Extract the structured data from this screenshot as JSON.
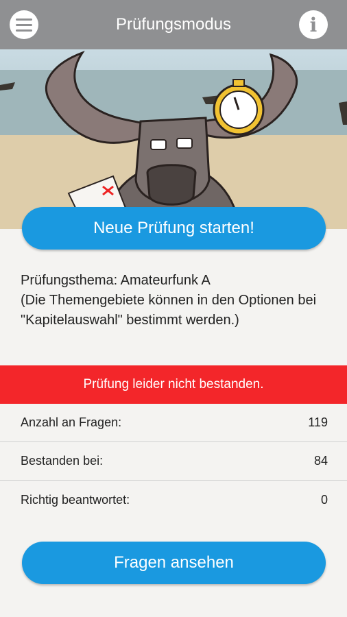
{
  "header": {
    "title": "Prüfungsmodus",
    "menu_icon": "hamburger-menu-icon",
    "info_icon": "info-icon"
  },
  "actions": {
    "start_label": "Neue Prüfung starten!",
    "review_label": "Fragen ansehen"
  },
  "topic": {
    "line": "Prüfungsthema: Amateurfunk A",
    "hint": "(Die Themengebiete können in den Optionen bei \"Kapitelauswahl\" bestimmt werden.)"
  },
  "result": {
    "banner": "Prüfung leider nicht bestanden."
  },
  "stats": [
    {
      "label": "Anzahl an Fragen:",
      "value": "119"
    },
    {
      "label": "Bestanden bei:",
      "value": "84"
    },
    {
      "label": "Richtig beantwortet:",
      "value": "0"
    }
  ],
  "colors": {
    "header": "#8f9092",
    "primary": "#1a99e0",
    "fail": "#f3262a",
    "background": "#f4f3f1"
  }
}
